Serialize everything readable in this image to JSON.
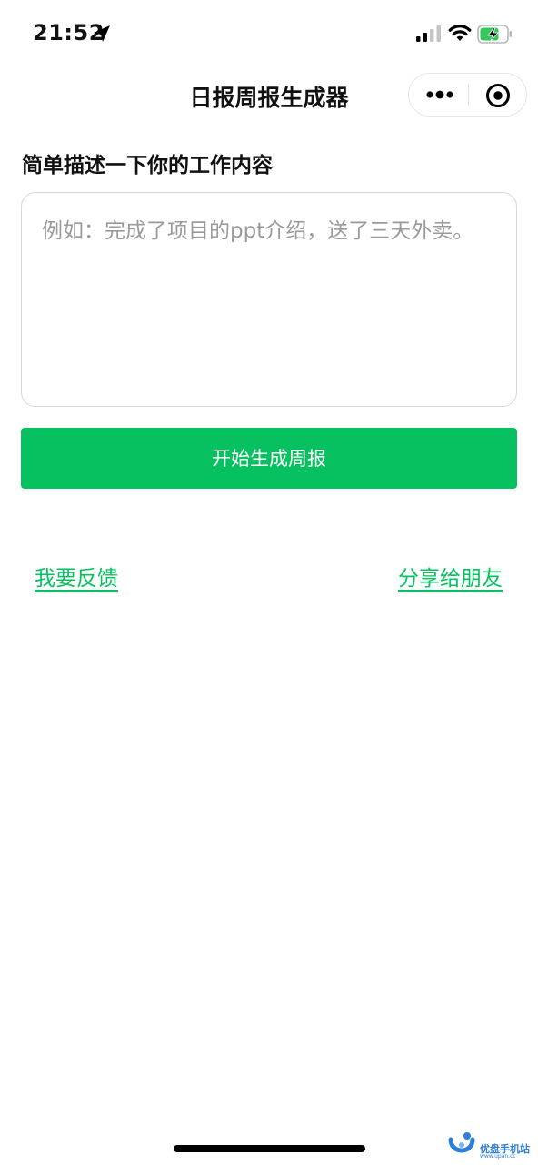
{
  "status_bar": {
    "time": "21:52",
    "icons": [
      "location-arrow-icon",
      "cellular-signal-icon",
      "wifi-icon",
      "battery-charging-icon"
    ]
  },
  "nav": {
    "title": "日报周报生成器",
    "capsule_icons": [
      "more-icon",
      "close-target-icon"
    ]
  },
  "form": {
    "label": "简单描述一下你的工作内容",
    "textarea_value": "",
    "textarea_placeholder": "例如：完成了项目的ppt介绍，送了三天外卖。",
    "submit_label": "开始生成周报"
  },
  "links": {
    "feedback": "我要反馈",
    "share": "分享给朋友"
  },
  "watermark": {
    "text": "优盘手机站",
    "sub": "www.upan.cc"
  },
  "colors": {
    "accent": "#07c160",
    "placeholder": "#9a9a9a",
    "border": "#d8d8d8"
  }
}
